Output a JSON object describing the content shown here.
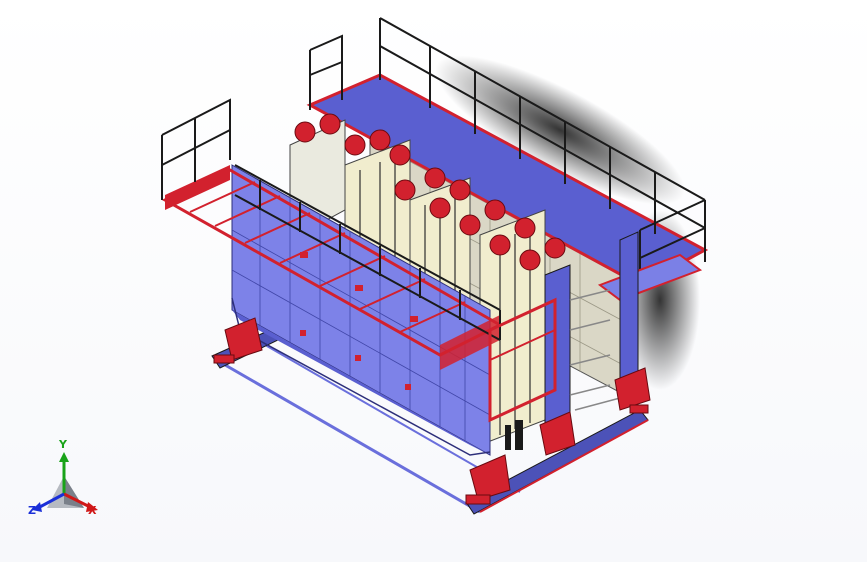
{
  "viewport": {
    "background": "#ffffff",
    "colors": {
      "panel": "#7b80e6",
      "panel_dark": "#4c52b8",
      "frame": "#d2212e",
      "rail": "#1a1a1a",
      "inner_panel": "#d9d6c4",
      "shadow": "#3d3d3d"
    }
  },
  "triad": {
    "x_label": "X",
    "y_label": "Y",
    "z_label": "Z",
    "x_color": "#d01818",
    "y_color": "#19a319",
    "z_color": "#1a2fd8"
  }
}
